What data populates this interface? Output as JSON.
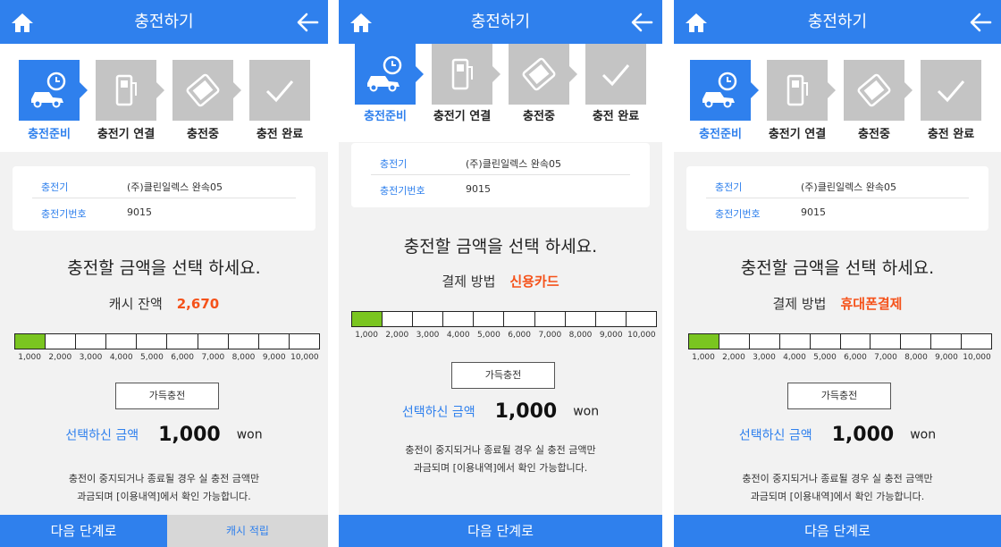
{
  "colors": {
    "primary": "#2f80ed",
    "accent": "#f5521a",
    "selected_segment": "#7ac520",
    "step_inactive": "#c4c4c4"
  },
  "icons": {
    "home": "home-icon",
    "back": "arrow-left-icon",
    "step1": "car-clock-icon",
    "step2": "charger-icon",
    "step3": "card-icon",
    "step4": "check-icon"
  },
  "screens": [
    {
      "header": {
        "title": "충전하기"
      },
      "steps": [
        "충전준비",
        "충전기 연결",
        "충전중",
        "충전 완료"
      ],
      "active_step": 0,
      "info": {
        "charger_label": "충전기",
        "charger_value": "(주)클린일렉스 완속05",
        "number_label": "충전기번호",
        "number_value": "9015"
      },
      "prompt": "충전할 금액을 선택 하세요.",
      "sub_label": "캐시 잔액",
      "sub_value": "2,670",
      "amount_options": [
        "1,000",
        "2,000",
        "3,000",
        "4,000",
        "5,000",
        "6,000",
        "7,000",
        "8,000",
        "9,000",
        "10,000"
      ],
      "selected_index": 0,
      "full_charge_label": "가득충전",
      "selected_label": "선택하신 금액",
      "selected_amount": "1,000",
      "unit": "won",
      "note_line1": "충전이 중지되거나 종료될 경우 실 충전 금액만",
      "note_line2": "과금되며 [이용내역]에서 확인 가능합니다.",
      "next_button": "다음 단계로",
      "cash_button": "캐시 적립"
    },
    {
      "header": {
        "title": "충전하기"
      },
      "steps": [
        "충전준비",
        "충전기 연결",
        "충전중",
        "충전 완료"
      ],
      "active_step": 0,
      "info": {
        "charger_label": "충전기",
        "charger_value": "(주)클린일렉스 완속05",
        "number_label": "충전기번호",
        "number_value": "9015"
      },
      "prompt": "충전할 금액을 선택 하세요.",
      "sub_label": "결제 방법",
      "sub_value": "신용카드",
      "amount_options": [
        "1,000",
        "2,000",
        "3,000",
        "4,000",
        "5,000",
        "6,000",
        "7,000",
        "8,000",
        "9,000",
        "10,000"
      ],
      "selected_index": 0,
      "full_charge_label": "가득충전",
      "selected_label": "선택하신 금액",
      "selected_amount": "1,000",
      "unit": "won",
      "note_line1": "충전이 중지되거나 종료될 경우 실 충전 금액만",
      "note_line2": "과금되며 [이용내역]에서 확인 가능합니다.",
      "next_button": "다음 단계로"
    },
    {
      "header": {
        "title": "충전하기"
      },
      "steps": [
        "충전준비",
        "충전기 연결",
        "충전중",
        "충전 완료"
      ],
      "active_step": 0,
      "info": {
        "charger_label": "충전기",
        "charger_value": "(주)클린일렉스 완속05",
        "number_label": "충전기번호",
        "number_value": "9015"
      },
      "prompt": "충전할 금액을 선택 하세요.",
      "sub_label": "결제 방법",
      "sub_value": "휴대폰결제",
      "amount_options": [
        "1,000",
        "2,000",
        "3,000",
        "4,000",
        "5,000",
        "6,000",
        "7,000",
        "8,000",
        "9,000",
        "10,000"
      ],
      "selected_index": 0,
      "full_charge_label": "가득충전",
      "selected_label": "선택하신 금액",
      "selected_amount": "1,000",
      "unit": "won",
      "note_line1": "충전이 중지되거나 종료될 경우 실 충전 금액만",
      "note_line2": "과금되며 [이용내역]에서 확인 가능합니다.",
      "next_button": "다음 단계로"
    }
  ]
}
